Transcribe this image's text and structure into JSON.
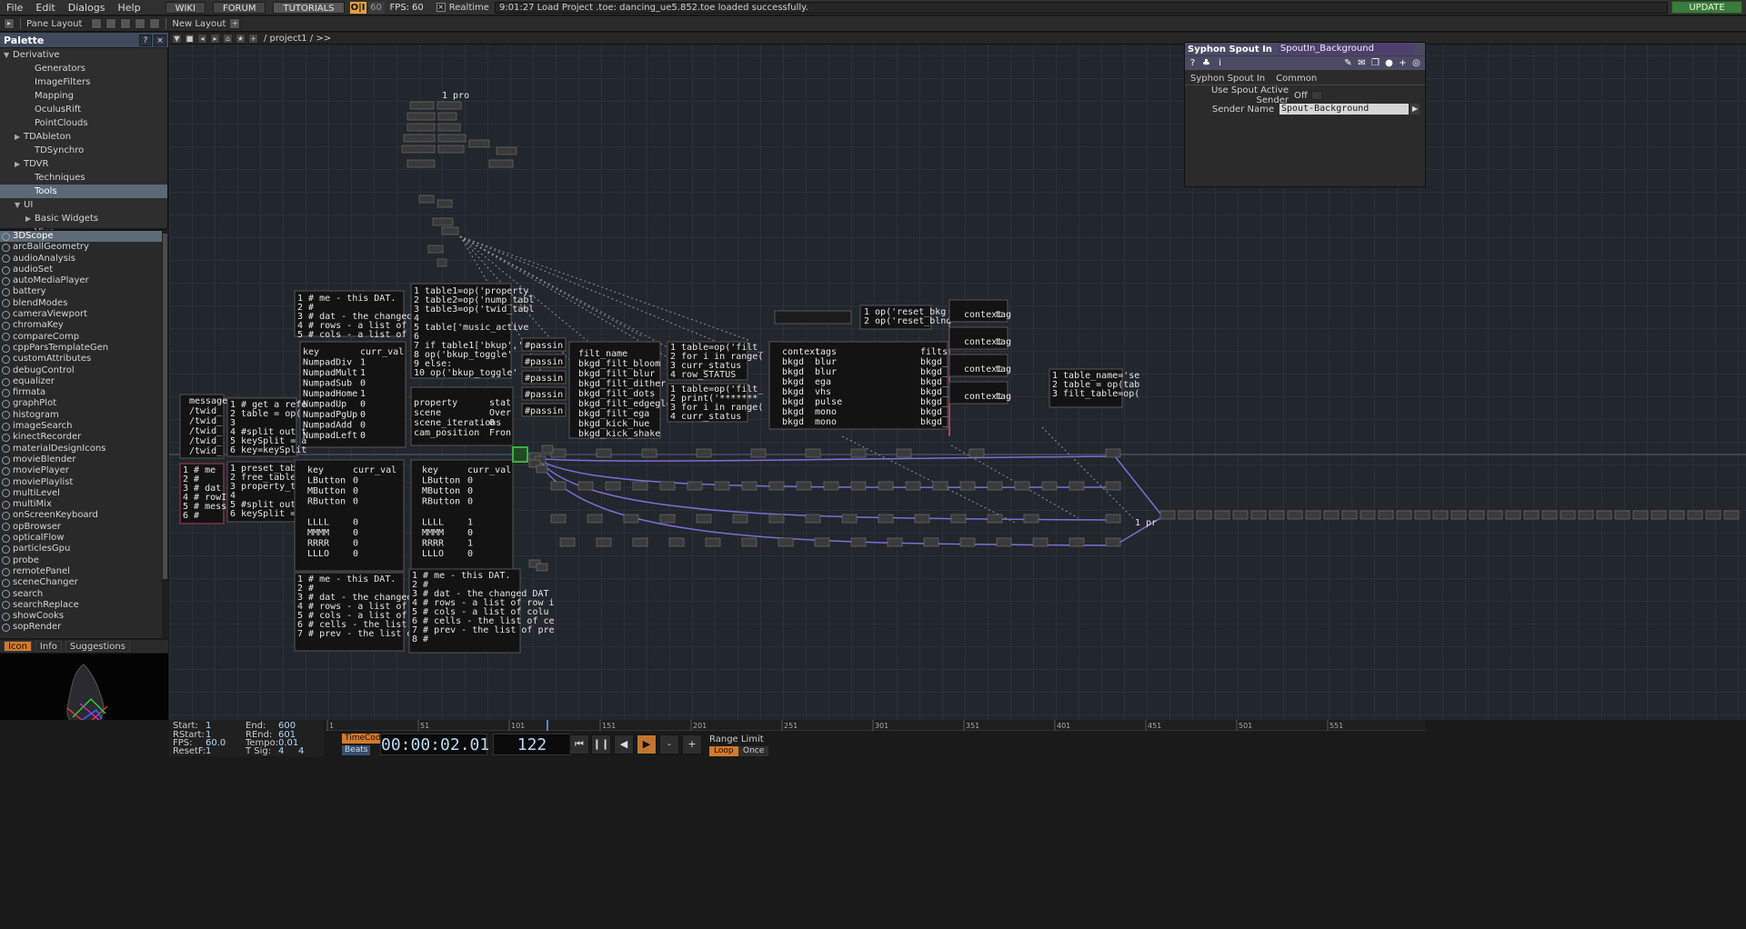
{
  "menu": {
    "items": [
      "File",
      "Edit",
      "Dialogs",
      "Help"
    ],
    "buttons": [
      "WIKI",
      "FORUM",
      "TUTORIALS"
    ],
    "perf_label": "O|I",
    "perf_value": "60",
    "fps_label": "FPS:",
    "fps_value": "60",
    "realtime_label": "Realtime",
    "status_message": "9:01:27 Load Project .toe: dancing_ue5.852.toe loaded successfully.",
    "update_label": "UPDATE"
  },
  "toolbar2": {
    "pane_layout": "Pane Layout",
    "new_layout": "New Layout"
  },
  "palette": {
    "title": "Palette",
    "help": "?",
    "close": "×",
    "tree": [
      {
        "label": "Derivative",
        "indent": 0,
        "tri": "▼",
        "sel": false
      },
      {
        "label": "Generators",
        "indent": 2,
        "tri": "",
        "sel": false
      },
      {
        "label": "ImageFilters",
        "indent": 2,
        "tri": "",
        "sel": false
      },
      {
        "label": "Mapping",
        "indent": 2,
        "tri": "",
        "sel": false
      },
      {
        "label": "OculusRift",
        "indent": 2,
        "tri": "",
        "sel": false
      },
      {
        "label": "PointClouds",
        "indent": 2,
        "tri": "",
        "sel": false
      },
      {
        "label": "TDAbleton",
        "indent": 1,
        "tri": "▶",
        "sel": false
      },
      {
        "label": "TDSynchro",
        "indent": 2,
        "tri": "",
        "sel": false
      },
      {
        "label": "TDVR",
        "indent": 1,
        "tri": "▶",
        "sel": false
      },
      {
        "label": "Techniques",
        "indent": 2,
        "tri": "",
        "sel": false
      },
      {
        "label": "Tools",
        "indent": 2,
        "tri": "",
        "sel": true
      },
      {
        "label": "UI",
        "indent": 1,
        "tri": "▼",
        "sel": false
      },
      {
        "label": "Basic Widgets",
        "indent": 2,
        "tri": "▶",
        "sel": false
      },
      {
        "label": "Vive",
        "indent": 2,
        "tri": "",
        "sel": false
      },
      {
        "label": "WebRTC",
        "indent": 2,
        "tri": "",
        "sel": false
      },
      {
        "label": "My Components",
        "indent": 0,
        "tri": "",
        "sel": false
      }
    ],
    "components": [
      "3DScope",
      "arcBallGeometry",
      "audioAnalysis",
      "audioSet",
      "autoMediaPlayer",
      "battery",
      "blendModes",
      "cameraViewport",
      "chromaKey",
      "compareComp",
      "cppParsTemplateGen",
      "customAttributes",
      "debugControl",
      "equalizer",
      "firmata",
      "graphPlot",
      "histogram",
      "imageSearch",
      "kinectRecorder",
      "materialDesignIcons",
      "movieBlender",
      "moviePlayer",
      "moviePlaylist",
      "multiLevel",
      "multiMix",
      "onScreenKeyboard",
      "opBrowser",
      "opticalFlow",
      "particlesGpu",
      "probe",
      "remotePanel",
      "sceneChanger",
      "search",
      "searchReplace",
      "showCooks",
      "sopRender"
    ]
  },
  "preview": {
    "tabs": [
      "Icon",
      "Info",
      "Suggestions"
    ]
  },
  "network": {
    "path": "/ project1 / >>",
    "dats": {
      "code_me_a": [
        "1 # me - this DAT.",
        "2 #",
        "3 # dat - the changed DAT",
        "4 # rows - a list of row",
        "5 # cols - a list of colu"
      ],
      "code_table": [
        "1 table1=op('property_",
        "2 table2=op('nump_tabl",
        "3 table3=op('twid_tabl",
        "4",
        "5 table['music_active",
        "6",
        "7 if table1['bkup','st",
        "8     op('bkup_toggle'",
        "9 else:",
        "10     op('bkup_toggle'"
      ],
      "numpad_keys": [
        "key",
        "NumpadDiv",
        "NumpadMult",
        "NumpadSub",
        "NumpadHome",
        "NumpadUp",
        "NumpadPgUp",
        "NumpadAdd",
        "NumpadLeft"
      ],
      "numpad_vals": [
        "curr_val",
        "1",
        "1",
        "0",
        "1",
        "0",
        "0",
        "0",
        "0"
      ],
      "prop_keys": [
        "property",
        "scene",
        "scene_iterations",
        "cam_position"
      ],
      "prop_vals": [
        "stat",
        "Over",
        "0",
        "Fron"
      ],
      "filt_names": [
        "filt_name",
        "bkgd_filt_bloom",
        "bkgd_filt_blur",
        "bkgd_filt_dither",
        "bkgd_filt_dots",
        "bkgd_filt_edgeglow",
        "bkgd_filt_ega",
        "bkgd_kick_hue",
        "bkgd_kick_shake"
      ],
      "code_filt_a": [
        "1 table=op('filt_",
        "2 for i in range(",
        "3     curr_status",
        "4     row_STATUS"
      ],
      "code_filt_b": [
        "1 table=op('filt_",
        "2 print('*******",
        "3 for i in range(",
        "4     curr_status"
      ],
      "context_ctx": [
        "context",
        "bkgd",
        "bkgd",
        "bkgd",
        "bkgd",
        "bkgd",
        "bkgd",
        "bkgd"
      ],
      "context_tags": [
        "tags",
        "blur",
        "blur",
        "ega",
        "vhs",
        "pulse",
        "mono",
        "mono"
      ],
      "context_filts": [
        "filts",
        "bkgd_",
        "bkgd_",
        "bkgd_",
        "bkgd_",
        "bkgd_",
        "bkgd_",
        "bkgd_"
      ],
      "code_reset": [
        "1 op('reset_bkg",
        "2 op('reset_blnd"
      ],
      "code_tablename": [
        "1 table_name='se",
        "2 table = op(tab",
        "3 filt_table=op("
      ],
      "twid_msg": [
        "message",
        "/twid_",
        "/twid_",
        "/twid_",
        "/twid_",
        "/twid_"
      ],
      "code_getref": [
        "1 # get a refe",
        "2 table = op(",
        "3",
        "4 #split out t",
        "5 keySplit = a",
        "6 key=keySplit"
      ],
      "code_me_b": [
        "1 # me",
        "2 #",
        "3 # dat",
        "4 # rowI",
        "5 # mess",
        "6 #"
      ],
      "code_preset": [
        "1 preset_table",
        "2 free_table =",
        "3 property_tab",
        "4",
        "5 #split out t",
        "6 keySplit = a"
      ],
      "mouse_keys": [
        "key",
        "LButton",
        "MButton",
        "RButton",
        "",
        "LLLL",
        "MMMM",
        "RRRR",
        "LLLO"
      ],
      "mouse_vals_a": [
        "curr_val",
        "0",
        "0",
        "0",
        "",
        "0",
        "0",
        "0",
        "0"
      ],
      "mouse_vals_b": [
        "curr_val",
        "0",
        "0",
        "0",
        "",
        "1",
        "0",
        "1",
        "0"
      ],
      "code_me_c": [
        "1 # me - this DAT.",
        "2 #",
        "3 # dat - the changed DAT",
        "4 # rows - a list of row",
        "5 # cols - a list of colu",
        "6 # cells - the list of c",
        "7 # prev - the list of pr"
      ],
      "code_me_d": [
        "1 # me - this DAT.",
        "2 #",
        "3 # dat - the changed DAT",
        "4 # rows - a list of row i",
        "5 # cols - a list of colu",
        "6 # cells - the list of ce",
        "7 # prev - the list of pre",
        "8 #"
      ],
      "passing": [
        "#passin",
        "#passin",
        "#passin",
        "#passin",
        "#passin"
      ],
      "mini_ctx": [
        "context",
        "context",
        "context",
        "context"
      ],
      "mini_tag": [
        "tag",
        "tag",
        "tag",
        "tag"
      ]
    }
  },
  "params": {
    "op_type": "Syphon Spout In",
    "op_name": "SpoutIn_Background",
    "tabs": [
      "Syphon Spout In",
      "Common"
    ],
    "use_active_label": "Use Spout Active Sender",
    "use_active_value": "Off",
    "sender_name_label": "Sender Name",
    "sender_name_value": "Spout-Background"
  },
  "range": {
    "start_label": "Start:",
    "start": "1",
    "end_label": "End:",
    "end": "600",
    "rstart_label": "RStart:",
    "rstart": "1",
    "rend_label": "REnd:",
    "rend": "601",
    "fps_label": "FPS:",
    "fps": "60.0",
    "tempo_label": "Tempo:",
    "tempo": "0.01",
    "resetf_label": "ResetF:",
    "resetf": "1",
    "tsig_label": "T Sig:",
    "tsig_a": "4",
    "tsig_b": "4"
  },
  "timeline": {
    "ticks": [
      "1",
      "51",
      "101",
      "151",
      "201",
      "251",
      "301",
      "351",
      "401",
      "451",
      "501",
      "551"
    ]
  },
  "transport": {
    "timecode_label": "TimeCode",
    "beats_label": "Beats",
    "timecode": "00:00:02.01",
    "frame": "122",
    "range_limit_label": "Range Limit",
    "loop_label": "Loop",
    "once_label": "Once",
    "minus": "-",
    "plus": "+"
  },
  "colors": {
    "accent_orange": "#d47a2a",
    "update_green": "#3a7a3a",
    "selected_node": "#3fae3f",
    "wire_purple": "#7a6fd6",
    "wire_pink": "#d44a8a"
  }
}
